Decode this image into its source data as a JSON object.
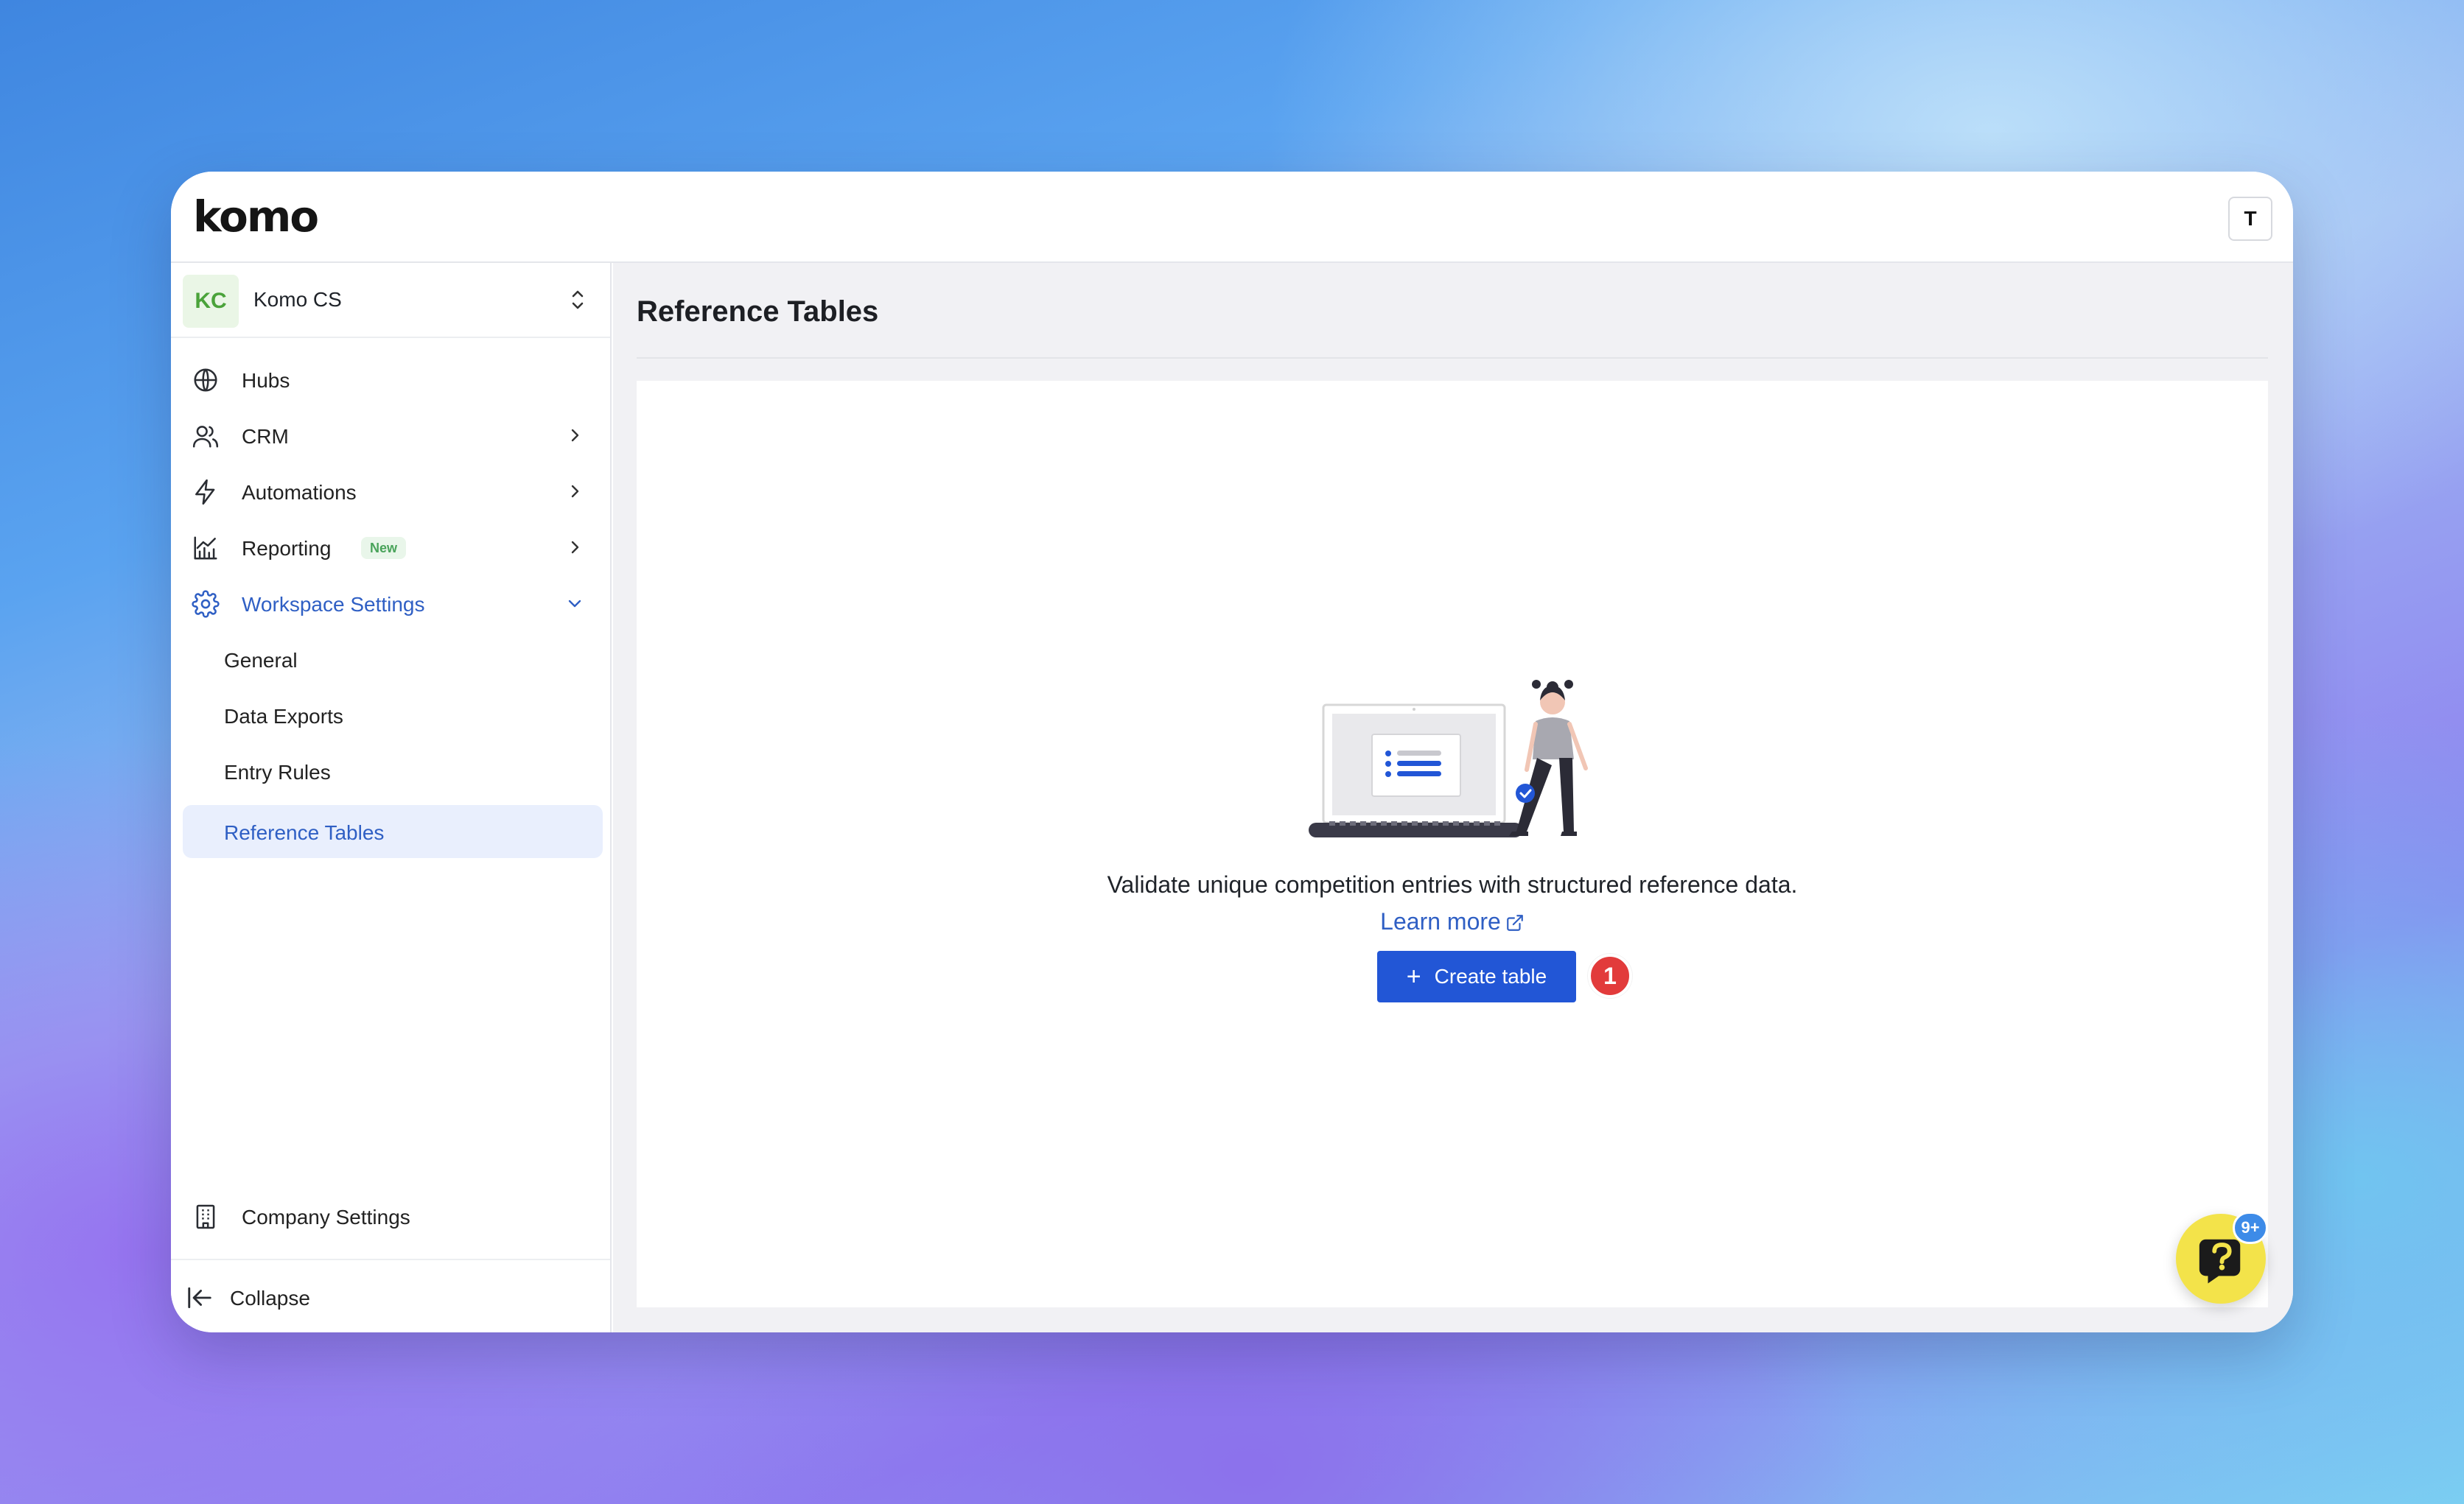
{
  "app": {
    "logo_text": "komo",
    "user_initial": "T"
  },
  "workspace": {
    "initials": "KC",
    "name": "Komo CS"
  },
  "sidebar": {
    "items": [
      {
        "label": "Hubs",
        "icon": "globe-icon"
      },
      {
        "label": "CRM",
        "icon": "users-icon"
      },
      {
        "label": "Automations",
        "icon": "lightning-icon"
      },
      {
        "label": "Reporting",
        "icon": "chart-icon",
        "badge": "New"
      },
      {
        "label": "Workspace Settings",
        "icon": "gear-icon",
        "expanded": true
      }
    ],
    "sub_items": [
      {
        "label": "General"
      },
      {
        "label": "Data Exports"
      },
      {
        "label": "Entry Rules"
      },
      {
        "label": "Reference Tables",
        "selected": true
      }
    ],
    "company_settings": "Company Settings",
    "collapse": "Collapse"
  },
  "main": {
    "title": "Reference Tables",
    "empty_state": {
      "text": "Validate unique competition entries with structured reference data.",
      "learn_more": "Learn more",
      "button": "Create table",
      "step_number": "1"
    }
  },
  "help": {
    "count": "9+"
  },
  "colors": {
    "accent": "#2256d6",
    "active_text": "#2f5fc4",
    "selected_bg": "#e9effd",
    "step_badge": "#e23b3b",
    "help_bg": "#f3e34a"
  }
}
